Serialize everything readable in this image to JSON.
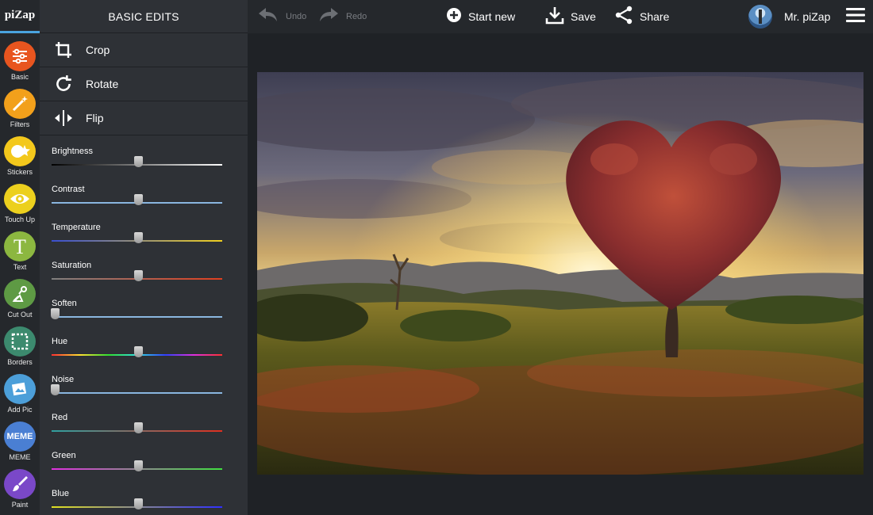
{
  "app": {
    "logo": "piZap"
  },
  "rail": {
    "tools": [
      {
        "id": "basic",
        "label": "Basic",
        "color": "#e8551f",
        "icon": "sliders-icon"
      },
      {
        "id": "filters",
        "label": "Filters",
        "color": "#f2a01b",
        "icon": "magic-wand-icon"
      },
      {
        "id": "stickers",
        "label": "Stickers",
        "color": "#f3c81c",
        "icon": "sticker-icon"
      },
      {
        "id": "touchup",
        "label": "Touch Up",
        "color": "#ecd01e",
        "icon": "eye-icon"
      },
      {
        "id": "text",
        "label": "Text",
        "color": "#8cb740",
        "icon": "text-t-icon"
      },
      {
        "id": "cutout",
        "label": "Cut Out",
        "color": "#5e9a44",
        "icon": "cutout-icon"
      },
      {
        "id": "borders",
        "label": "Borders",
        "color": "#3c8a6e",
        "icon": "border-frame-icon"
      },
      {
        "id": "addpic",
        "label": "Add Pic",
        "color": "#4c9fd9",
        "icon": "add-picture-icon"
      },
      {
        "id": "meme",
        "label": "MEME",
        "color": "#4a7fd3",
        "icon": "meme-icon",
        "icon_text": "MEME"
      },
      {
        "id": "paint",
        "label": "Paint",
        "color": "#7a48c8",
        "icon": "paint-brush-icon"
      }
    ]
  },
  "panel": {
    "title": "BASIC EDITS",
    "actions": [
      {
        "label": "Crop",
        "icon": "crop-icon"
      },
      {
        "label": "Rotate",
        "icon": "rotate-icon"
      },
      {
        "label": "Flip",
        "icon": "flip-icon"
      }
    ],
    "sliders": [
      {
        "label": "Brightness",
        "value": 0.5,
        "track": "linear-gradient(90deg,#000,#fff)"
      },
      {
        "label": "Contrast",
        "value": 0.5,
        "track": "linear-gradient(90deg,#8ab6e0,#8ab6e0)"
      },
      {
        "label": "Temperature",
        "value": 0.5,
        "track": "linear-gradient(90deg,#3a4fd0,#f0d020)"
      },
      {
        "label": "Saturation",
        "value": 0.5,
        "track": "linear-gradient(90deg,#808080,#e04020)"
      },
      {
        "label": "Soften",
        "value": 0.0,
        "track": "linear-gradient(90deg,#8ab6e0,#8ab6e0)"
      },
      {
        "label": "Hue",
        "value": 0.5,
        "track": "linear-gradient(90deg,#ff3030,#ffe030,#30e030,#30e0e0,#3040ff,#e030e0,#ff3030)"
      },
      {
        "label": "Noise",
        "value": 0.0,
        "track": "linear-gradient(90deg,#8ab6e0,#8ab6e0)"
      },
      {
        "label": "Red",
        "value": 0.5,
        "track": "linear-gradient(90deg,#30a0a0,#e03020)"
      },
      {
        "label": "Green",
        "value": 0.5,
        "track": "linear-gradient(90deg,#e030e0,#40e040)"
      },
      {
        "label": "Blue",
        "value": 0.5,
        "track": "linear-gradient(90deg,#e0e020,#3030ff)"
      }
    ]
  },
  "topbar": {
    "undo": "Undo",
    "redo": "Redo",
    "start_new": "Start new",
    "save": "Save",
    "share": "Share",
    "user_name": "Mr. piZap"
  }
}
